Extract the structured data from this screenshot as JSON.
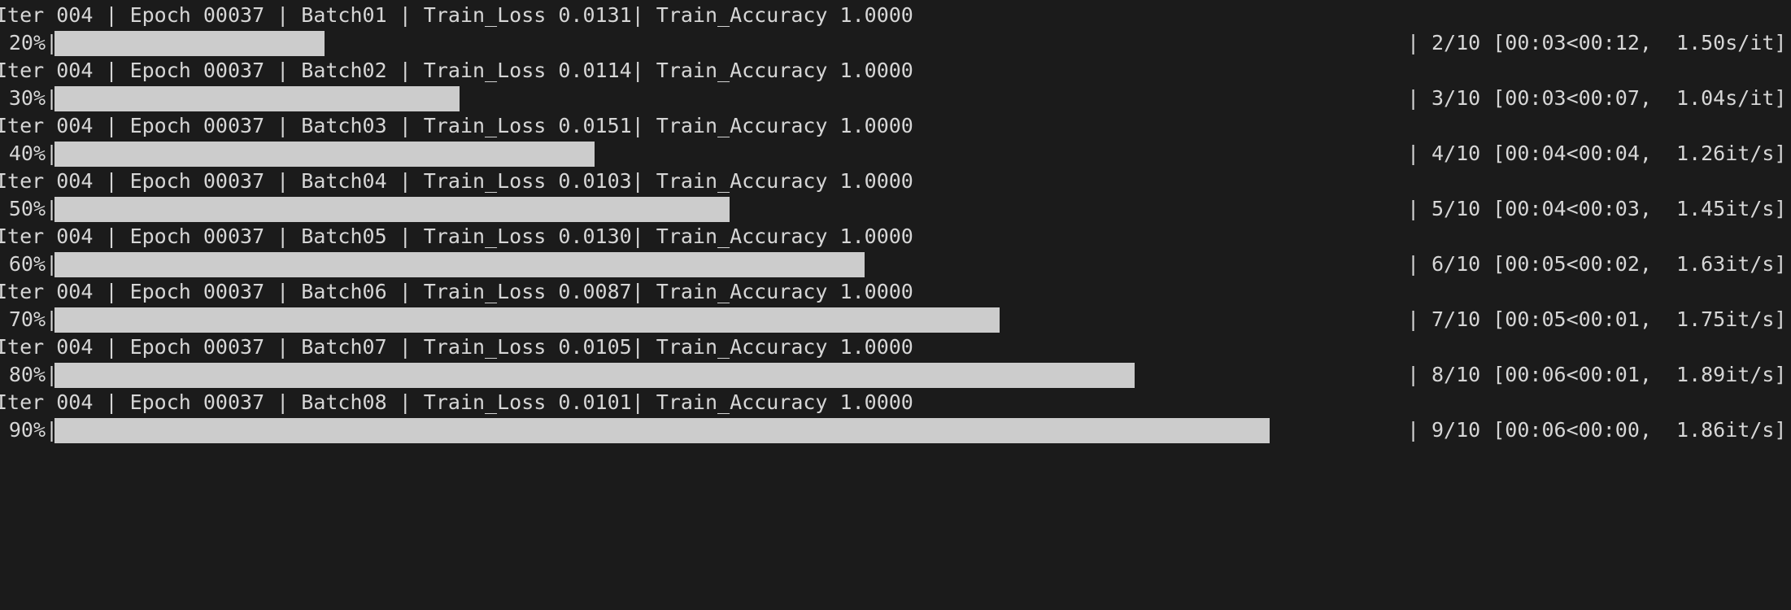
{
  "terminal": {
    "background": "#1b1b1b",
    "text_color": "#d6d6d6",
    "bar_color": "#cccccc",
    "entries": [
      {
        "log": "Iter 004 | Epoch 00037 | Batch01 | Train_Loss 0.0131| Train_Accuracy 1.0000",
        "percent": "20%",
        "left_sep": "|",
        "fraction": 0.2,
        "right_sep": "|",
        "stats": "2/10 [00:03<00:12,  1.50s/it]"
      },
      {
        "log": "Iter 004 | Epoch 00037 | Batch02 | Train_Loss 0.0114| Train_Accuracy 1.0000",
        "percent": "30%",
        "left_sep": "|",
        "fraction": 0.3,
        "right_sep": "|",
        "stats": "3/10 [00:03<00:07,  1.04s/it]"
      },
      {
        "log": "Iter 004 | Epoch 00037 | Batch03 | Train_Loss 0.0151| Train_Accuracy 1.0000",
        "percent": "40%",
        "left_sep": "|",
        "fraction": 0.4,
        "right_sep": "|",
        "stats": "4/10 [00:04<00:04,  1.26it/s]"
      },
      {
        "log": "Iter 004 | Epoch 00037 | Batch04 | Train_Loss 0.0103| Train_Accuracy 1.0000",
        "percent": "50%",
        "left_sep": "|",
        "fraction": 0.5,
        "right_sep": "|",
        "stats": "5/10 [00:04<00:03,  1.45it/s]"
      },
      {
        "log": "Iter 004 | Epoch 00037 | Batch05 | Train_Loss 0.0130| Train_Accuracy 1.0000",
        "percent": "60%",
        "left_sep": "|",
        "fraction": 0.6,
        "right_sep": "|",
        "stats": "6/10 [00:05<00:02,  1.63it/s]"
      },
      {
        "log": "Iter 004 | Epoch 00037 | Batch06 | Train_Loss 0.0087| Train_Accuracy 1.0000",
        "percent": "70%",
        "left_sep": "|",
        "fraction": 0.7,
        "right_sep": "|",
        "stats": "7/10 [00:05<00:01,  1.75it/s]"
      },
      {
        "log": "Iter 004 | Epoch 00037 | Batch07 | Train_Loss 0.0105| Train_Accuracy 1.0000",
        "percent": "80%",
        "left_sep": "|",
        "fraction": 0.8,
        "right_sep": "|",
        "stats": "8/10 [00:06<00:01,  1.89it/s]"
      },
      {
        "log": "Iter 004 | Epoch 00037 | Batch08 | Train_Loss 0.0101| Train_Accuracy 1.0000",
        "percent": "90%",
        "left_sep": "|",
        "fraction": 0.9,
        "right_sep": "|",
        "stats": "9/10 [00:06<00:00,  1.86it/s]"
      }
    ]
  }
}
